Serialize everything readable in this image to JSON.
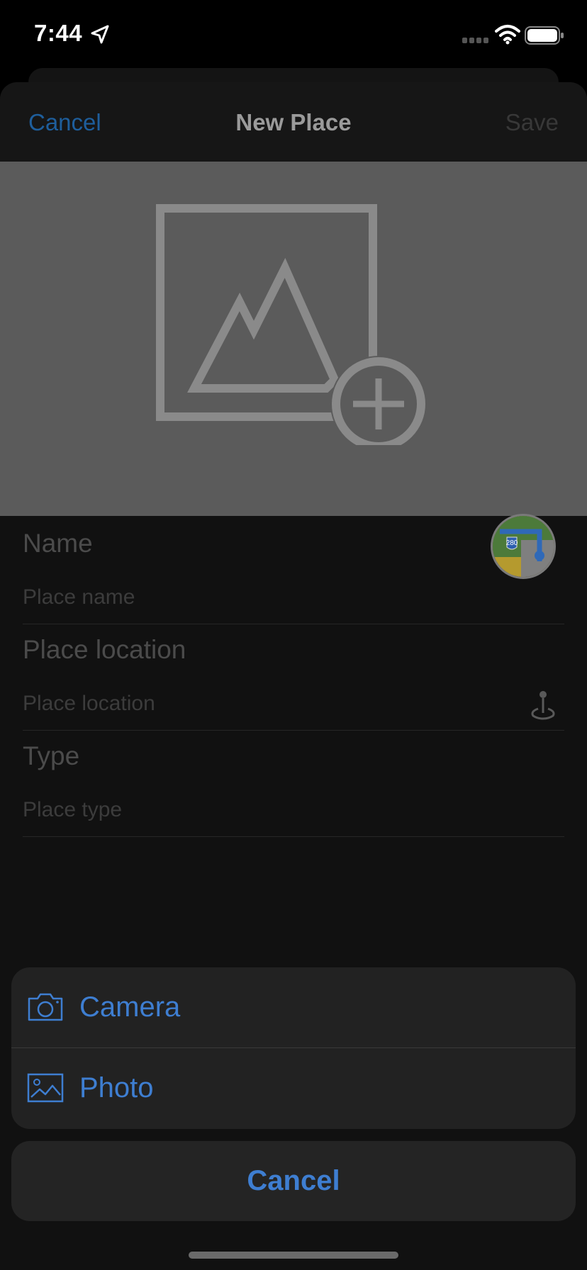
{
  "status_bar": {
    "time": "7:44",
    "icons": [
      "location-arrow-icon",
      "cellular-signal-icon",
      "wifi-icon",
      "battery-icon"
    ]
  },
  "nav": {
    "cancel_label": "Cancel",
    "title": "New Place",
    "save_label": "Save"
  },
  "image_area": {
    "placeholder_icon": "image-add-icon",
    "maps_icon": "maps-app-icon",
    "maps_badge": "280"
  },
  "form": {
    "name_label": "Name",
    "name_placeholder": "Place name",
    "location_label": "Place location",
    "location_placeholder": "Place location",
    "location_icon": "map-pin-icon",
    "type_label": "Type",
    "type_placeholder": "Place type"
  },
  "rating": {
    "value": 0,
    "max": 5
  },
  "action_sheet": {
    "camera_label": "Camera",
    "camera_icon": "camera-icon",
    "photo_label": "Photo",
    "photo_icon": "photo-icon",
    "cancel_label": "Cancel"
  },
  "colors": {
    "accent": "#3e7ed1",
    "dimmed_accent": "#1e5e9c",
    "image_background": "#5b5b5b"
  }
}
